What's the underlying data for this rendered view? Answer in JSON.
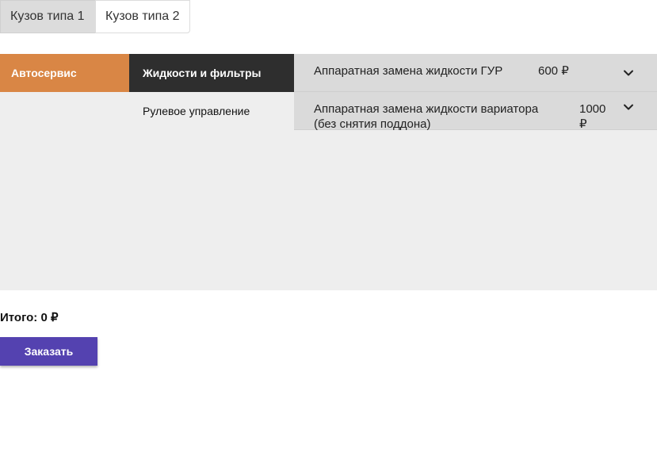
{
  "tabs": [
    {
      "label": "Кузов типа 1",
      "active": true
    },
    {
      "label": "Кузов типа 2",
      "active": false
    }
  ],
  "categories": [
    {
      "label": "Автосервис",
      "active": true
    }
  ],
  "subcategories": [
    {
      "label": "Жидкости и фильтры",
      "active": true
    },
    {
      "label": "Рулевое управление",
      "active": false
    }
  ],
  "services": [
    {
      "name": "Аппаратная замена жидкости ГУР",
      "price": "600 ₽",
      "icon": "chevron-down-icon"
    },
    {
      "name": "Аппаратная замена жидкости вариатора (без снятия поддона)",
      "price": "1000 ₽",
      "icon": "chevron-down-icon"
    }
  ],
  "summary": {
    "total": "Итого: 0 ₽",
    "order_label": "Заказать"
  },
  "colors": {
    "category_active": "#d98645",
    "subcategory_active": "#2e2e2e",
    "order_button": "#5442b0",
    "panel_background": "#eeeeee",
    "service_row": "#dadada"
  }
}
